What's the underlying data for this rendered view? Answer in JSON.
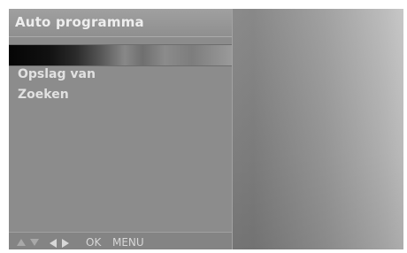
{
  "menu": {
    "title": "Auto programma",
    "selected_item": "",
    "items": [
      {
        "label": "Opslag van"
      },
      {
        "label": "Zoeken"
      }
    ]
  },
  "footer": {
    "ok_label": "OK",
    "menu_label": "MENU",
    "icons": [
      "up-arrow",
      "down-arrow",
      "left-arrow",
      "right-arrow"
    ]
  },
  "colors": {
    "background": "#8c8c8c",
    "text": "#e1e1e1",
    "highlight_left": "#050505",
    "highlight_right": "#9a9a9a"
  }
}
